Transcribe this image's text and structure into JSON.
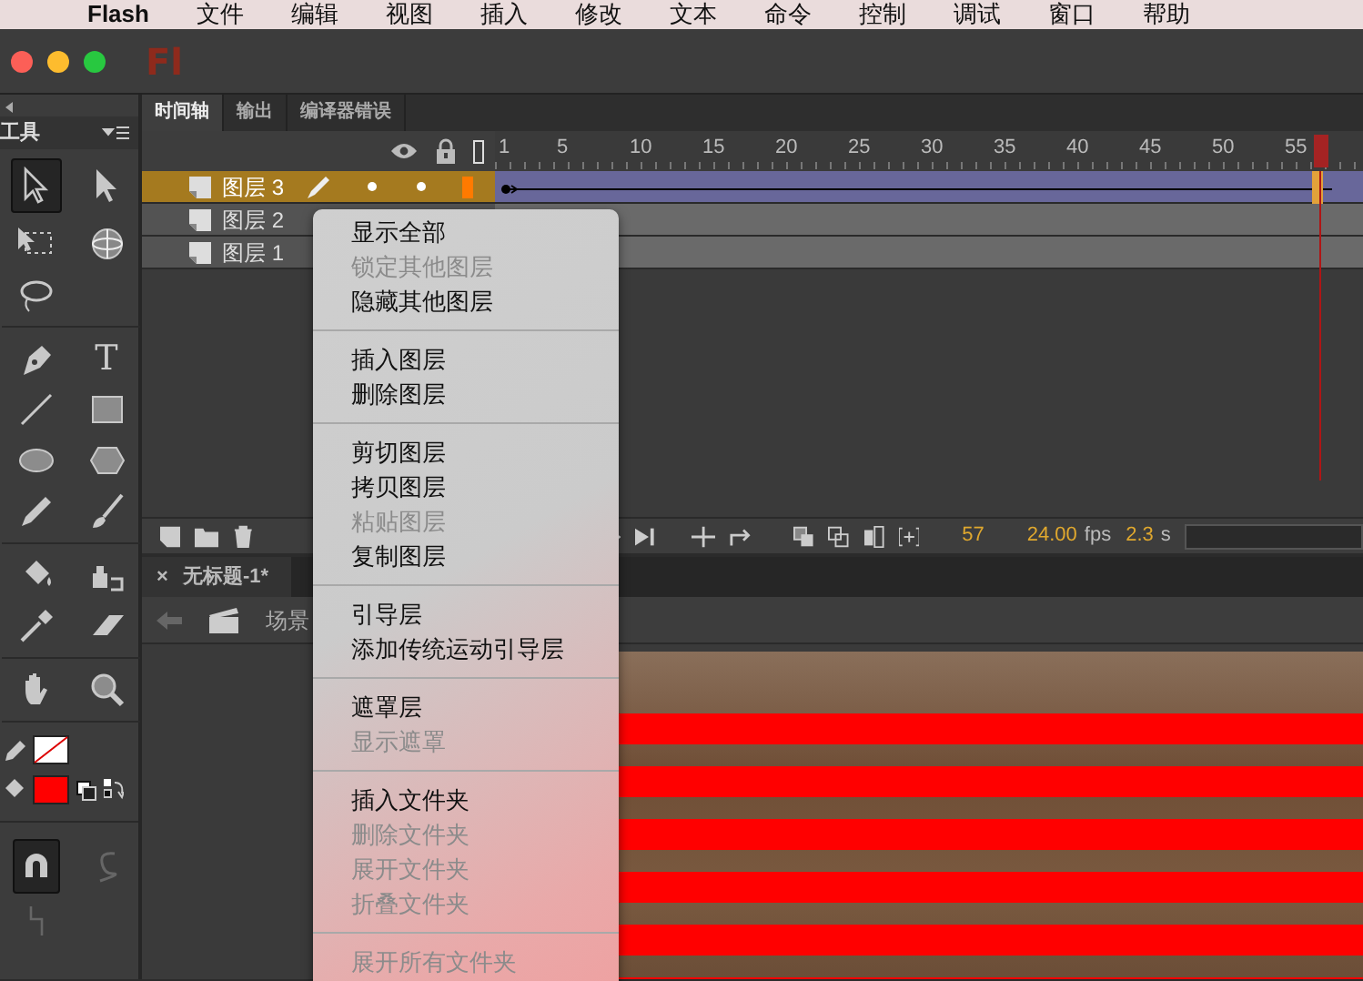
{
  "menubar": {
    "items": [
      "Flash",
      "文件",
      "编辑",
      "视图",
      "插入",
      "修改",
      "文本",
      "命令",
      "控制",
      "调试",
      "窗口",
      "帮助"
    ]
  },
  "app_logo": "Fl",
  "tools_panel": {
    "title": "工具",
    "text_tool_glyph": "T"
  },
  "timeline": {
    "tabs": [
      {
        "label": "时间轴",
        "selected": true
      },
      {
        "label": "输出",
        "selected": false
      },
      {
        "label": "编译器错误",
        "selected": false
      }
    ],
    "frame_numbers": [
      "1",
      "5",
      "10",
      "15",
      "20",
      "25",
      "30",
      "35",
      "40",
      "45",
      "50",
      "55"
    ],
    "layers": [
      {
        "name": "图层 3",
        "selected": true
      },
      {
        "name": "图层 2",
        "selected": false
      },
      {
        "name": "图层 1",
        "selected": false
      }
    ],
    "status": {
      "current_frame": "57",
      "fps": "24.00",
      "fps_unit": "fps",
      "time": "2.3",
      "time_unit": "s"
    }
  },
  "document_tabs": [
    {
      "close": "×",
      "label": "无标题-1*",
      "selected": true
    }
  ],
  "breadcrumb": "场景",
  "context_menu": {
    "groups": [
      [
        {
          "label": "显示全部",
          "disabled": false
        },
        {
          "label": "锁定其他图层",
          "disabled": true
        },
        {
          "label": "隐藏其他图层",
          "disabled": false
        }
      ],
      [
        {
          "label": "插入图层",
          "disabled": false
        },
        {
          "label": "删除图层",
          "disabled": false
        }
      ],
      [
        {
          "label": "剪切图层",
          "disabled": false
        },
        {
          "label": "拷贝图层",
          "disabled": false
        },
        {
          "label": "粘贴图层",
          "disabled": true
        },
        {
          "label": "复制图层",
          "disabled": false
        }
      ],
      [
        {
          "label": "引导层",
          "disabled": false
        },
        {
          "label": "添加传统运动引导层",
          "disabled": false
        }
      ],
      [
        {
          "label": "遮罩层",
          "disabled": false
        },
        {
          "label": "显示遮罩",
          "disabled": true
        }
      ],
      [
        {
          "label": "插入文件夹",
          "disabled": false
        },
        {
          "label": "删除文件夹",
          "disabled": true
        },
        {
          "label": "展开文件夹",
          "disabled": true
        },
        {
          "label": "折叠文件夹",
          "disabled": true
        }
      ],
      [
        {
          "label": "展开所有文件夹",
          "disabled": true
        }
      ]
    ]
  }
}
